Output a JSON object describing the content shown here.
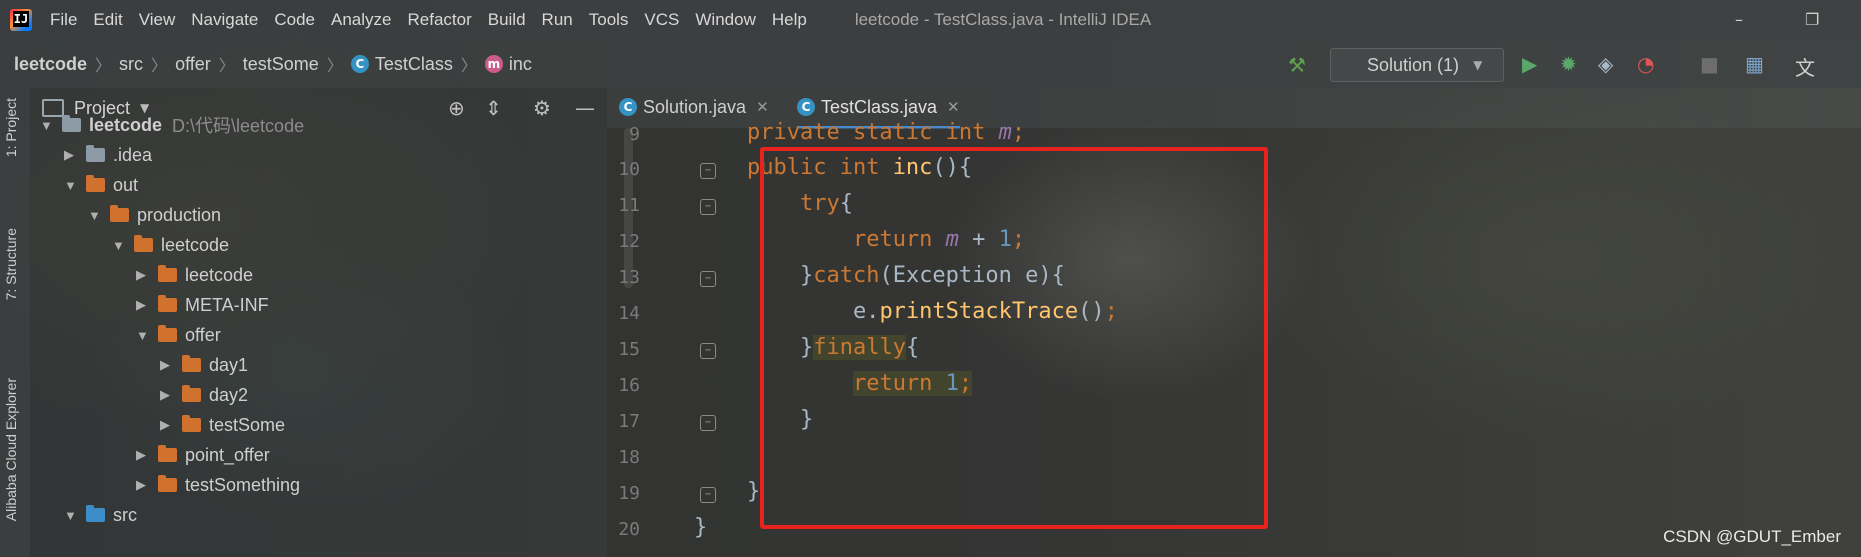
{
  "window": {
    "title": "leetcode - TestClass.java - IntelliJ IDEA",
    "app_icon_text": "IJ",
    "controls": [
      "–",
      "❐"
    ]
  },
  "menu": [
    "File",
    "Edit",
    "View",
    "Navigate",
    "Code",
    "Analyze",
    "Refactor",
    "Build",
    "Run",
    "Tools",
    "VCS",
    "Window",
    "Help"
  ],
  "breadcrumb": {
    "items": [
      "leetcode",
      "src",
      "offer",
      "testSome",
      "TestClass",
      "inc"
    ],
    "class_icon": "C",
    "method_icon": "m"
  },
  "toolbar": {
    "run_config": "Solution (1)",
    "icons": [
      "hammer-icon",
      "run-icon",
      "debug-icon",
      "coverage-icon",
      "profile-icon",
      "stop-icon",
      "project-structure-icon",
      "translate-icon"
    ]
  },
  "side_tabs": [
    "1: Project",
    "7: Structure",
    "Alibaba Cloud Explorer"
  ],
  "project_panel": {
    "title": "Project",
    "tree": [
      {
        "label": "leetcode",
        "hint": "D:\\代码\\leetcode",
        "depth": 0,
        "expanded": true,
        "color": "grey"
      },
      {
        "label": ".idea",
        "depth": 1,
        "expanded": false,
        "color": "grey"
      },
      {
        "label": "out",
        "depth": 1,
        "expanded": true,
        "color": "orange"
      },
      {
        "label": "production",
        "depth": 2,
        "expanded": true,
        "color": "orange"
      },
      {
        "label": "leetcode",
        "depth": 3,
        "expanded": true,
        "color": "orange"
      },
      {
        "label": "leetcode",
        "depth": 4,
        "expanded": false,
        "color": "orange"
      },
      {
        "label": "META-INF",
        "depth": 4,
        "expanded": false,
        "color": "orange"
      },
      {
        "label": "offer",
        "depth": 4,
        "expanded": true,
        "color": "orange"
      },
      {
        "label": "day1",
        "depth": 5,
        "expanded": false,
        "color": "orange"
      },
      {
        "label": "day2",
        "depth": 5,
        "expanded": false,
        "color": "orange"
      },
      {
        "label": "testSome",
        "depth": 5,
        "expanded": false,
        "color": "orange"
      },
      {
        "label": "point_offer",
        "depth": 4,
        "expanded": false,
        "color": "orange"
      },
      {
        "label": "testSomething",
        "depth": 4,
        "expanded": false,
        "color": "orange"
      },
      {
        "label": "src",
        "depth": 1,
        "expanded": true,
        "color": "blue"
      }
    ]
  },
  "editor": {
    "tabs": [
      {
        "label": "Solution.java",
        "active": false
      },
      {
        "label": "TestClass.java",
        "active": true
      }
    ],
    "line_numbers": [
      "9",
      "10",
      "11",
      "12",
      "13",
      "14",
      "15",
      "16",
      "17",
      "18",
      "19",
      "20"
    ],
    "lines": [
      [
        {
          "t": "    "
        },
        {
          "t": "private static int ",
          "c": "kw"
        },
        {
          "t": "m",
          "c": "fld"
        },
        {
          "t": ";",
          "c": "kw"
        }
      ],
      [
        {
          "t": "    "
        },
        {
          "t": "public int ",
          "c": "kw"
        },
        {
          "t": "inc",
          "c": "mth"
        },
        {
          "t": "(){"
        }
      ],
      [
        {
          "t": "        "
        },
        {
          "t": "try",
          "c": "kw"
        },
        {
          "t": "{"
        }
      ],
      [
        {
          "t": "            "
        },
        {
          "t": "return ",
          "c": "kw"
        },
        {
          "t": "m",
          "c": "fld"
        },
        {
          "t": " + "
        },
        {
          "t": "1",
          "c": "num"
        },
        {
          "t": ";",
          "c": "kw"
        }
      ],
      [
        {
          "t": "        }"
        },
        {
          "t": "catch",
          "c": "kw"
        },
        {
          "t": "(Exception e){"
        }
      ],
      [
        {
          "t": "            e."
        },
        {
          "t": "printStackTrace",
          "c": "mth"
        },
        {
          "t": "()"
        },
        {
          "t": ";",
          "c": "kw"
        }
      ],
      [
        {
          "t": "        }"
        },
        {
          "t": "finally",
          "c": "kw hl"
        },
        {
          "t": "{"
        }
      ],
      [
        {
          "t": "            "
        },
        {
          "t": "return ",
          "c": "kw hl"
        },
        {
          "t": "1",
          "c": "num hl"
        },
        {
          "t": ";",
          "c": "kw hl"
        }
      ],
      [
        {
          "t": "        }"
        }
      ],
      [
        {
          "t": ""
        }
      ],
      [
        {
          "t": "    }"
        }
      ],
      [
        {
          "t": "}"
        }
      ]
    ]
  },
  "watermark": "CSDN @GDUT_Ember"
}
